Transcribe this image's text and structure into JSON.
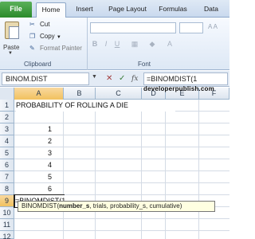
{
  "ribbon": {
    "tabs": [
      "File",
      "Home",
      "Insert",
      "Page Layout",
      "Formulas",
      "Data"
    ],
    "active_tab": "Home",
    "clipboard": {
      "paste_label": "Paste",
      "cut_label": "Cut",
      "copy_label": "Copy",
      "format_painter_label": "Format Painter",
      "group_label": "Clipboard"
    },
    "font": {
      "group_label": "Font"
    }
  },
  "formula_bar": {
    "name_box": "BINOM.DIST",
    "formula": "=BINOMDIST(1"
  },
  "grid": {
    "columns": [
      "A",
      "B",
      "C",
      "D",
      "E",
      "F"
    ],
    "active_column": "A",
    "rows": [
      "1",
      "2",
      "3",
      "4",
      "5",
      "6",
      "7",
      "8",
      "9",
      "10",
      "11",
      "12"
    ],
    "active_row": "9",
    "cells": {
      "A1": "PROBABILITY OF ROLLING A DIE",
      "A3": "1",
      "A4": "2",
      "A5": "3",
      "A6": "4",
      "A7": "5",
      "A8": "6",
      "A9": "=BINOMDIST(1"
    }
  },
  "tooltip": {
    "func": "BINOMDIST(",
    "current_arg": "number_s",
    "rest": ", trials, probability_s, cumulative)"
  },
  "watermark": "developerpublish.com"
}
